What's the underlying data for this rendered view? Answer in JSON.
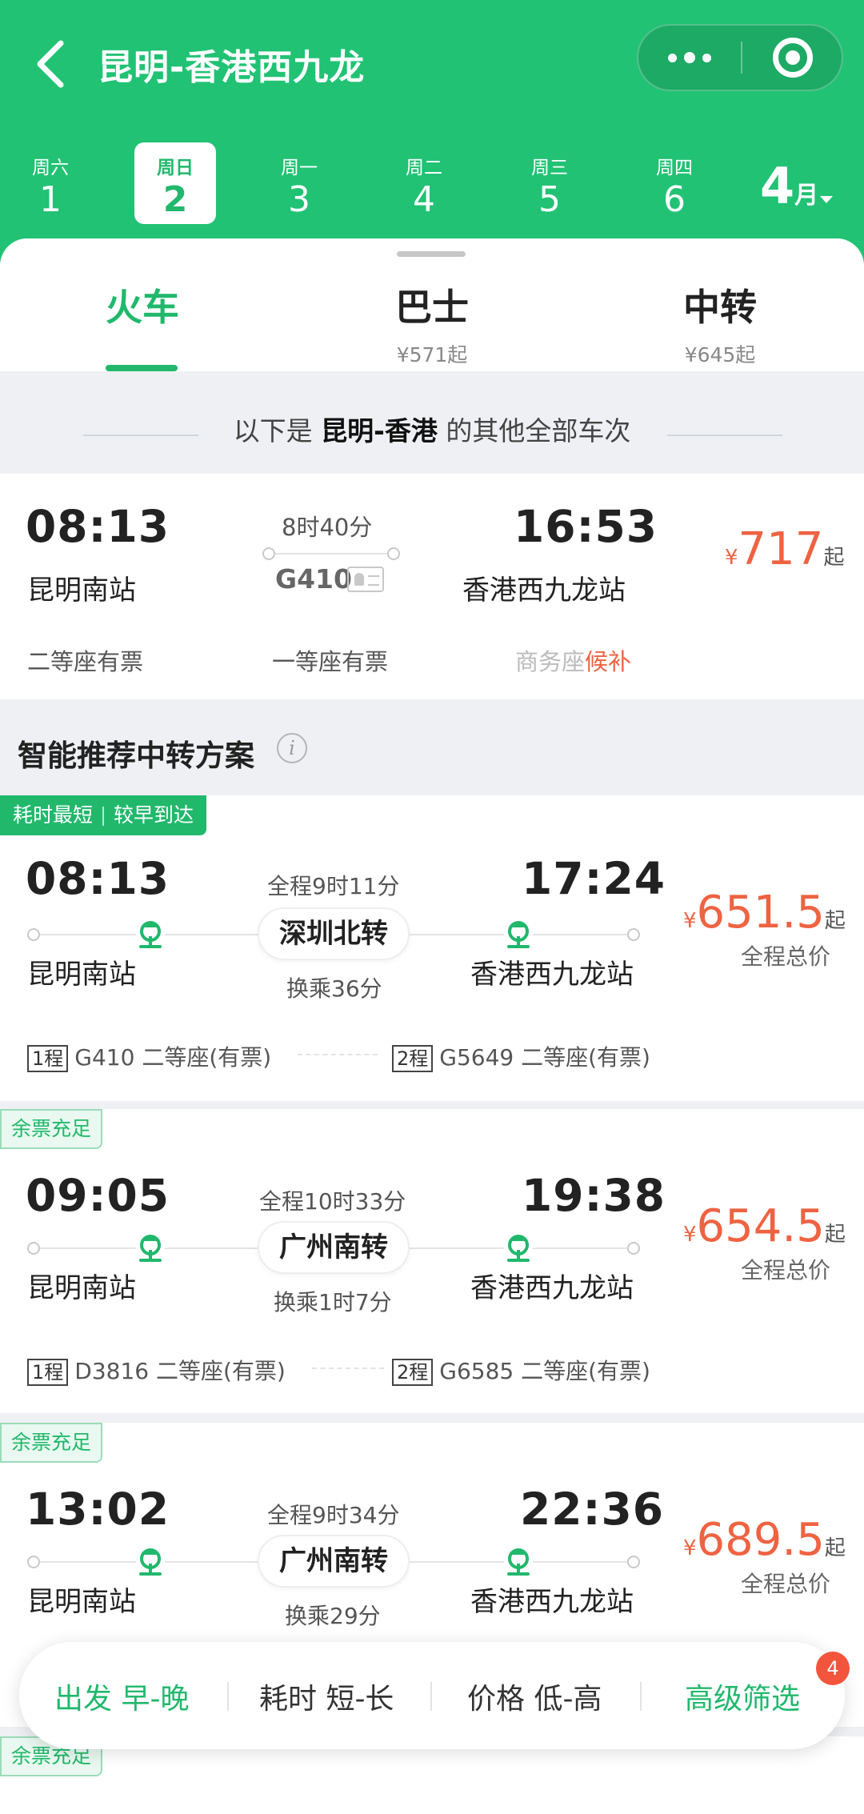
{
  "header": {
    "title": "昆明-香港西九龙",
    "dates": [
      {
        "weekday": "周六",
        "day": "1"
      },
      {
        "weekday": "周日",
        "day": "2"
      },
      {
        "weekday": "周一",
        "day": "3"
      },
      {
        "weekday": "周二",
        "day": "4"
      },
      {
        "weekday": "周三",
        "day": "5"
      },
      {
        "weekday": "周四",
        "day": "6"
      }
    ],
    "month_num": "4",
    "month_unit": "月"
  },
  "tabs": [
    {
      "label": "火车",
      "sub": ""
    },
    {
      "label": "巴士",
      "sub": "¥571起"
    },
    {
      "label": "中转",
      "sub": "¥645起"
    }
  ],
  "notice": {
    "prefix": "以下是 ",
    "route": "昆明-香港",
    "suffix": " 的其他全部车次"
  },
  "direct": {
    "depart_time": "08:13",
    "depart_station": "昆明南站",
    "duration": "8时40分",
    "train_no": "G410",
    "arrive_time": "16:53",
    "arrive_station": "香港西九龙站",
    "price_currency": "¥",
    "price": "717",
    "price_suffix": "起",
    "seat1": "二等座有票",
    "seat2": "一等座有票",
    "seat3_label": "商务座",
    "seat3_status": "候补"
  },
  "smart": {
    "title": "智能推荐中转方案",
    "info_icon": "i"
  },
  "transfers": [
    {
      "tags": [
        "耗时最短",
        "较早到达"
      ],
      "depart_time": "08:13",
      "depart_station": "昆明南站",
      "total": "全程9时11分",
      "via": "深圳北转",
      "wait": "换乘36分",
      "arrive_time": "17:24",
      "arrive_station": "香港西九龙站",
      "price_currency": "¥",
      "price": "651.5",
      "price_suffix": "起",
      "price_label": "全程总价",
      "leg1_badge": "1程",
      "leg1": "G410 二等座(有票)",
      "leg2_badge": "2程",
      "leg2": "G5649 二等座(有票)"
    },
    {
      "tags": [
        "余票充足"
      ],
      "depart_time": "09:05",
      "depart_station": "昆明南站",
      "total": "全程10时33分",
      "via": "广州南转",
      "wait": "换乘1时7分",
      "arrive_time": "19:38",
      "arrive_station": "香港西九龙站",
      "price_currency": "¥",
      "price": "654.5",
      "price_suffix": "起",
      "price_label": "全程总价",
      "leg1_badge": "1程",
      "leg1": "D3816 二等座(有票)",
      "leg2_badge": "2程",
      "leg2": "G6585 二等座(有票)"
    },
    {
      "tags": [
        "余票充足"
      ],
      "depart_time": "13:02",
      "depart_station": "昆明南站",
      "total": "全程9时34分",
      "via": "广州南转",
      "wait": "换乘29分",
      "arrive_time": "22:36",
      "arrive_station": "香港西九龙站",
      "price_currency": "¥",
      "price": "689.5",
      "price_suffix": "起",
      "price_label": "全程总价"
    },
    {
      "tags": [
        "余票充足"
      ]
    }
  ],
  "filter": {
    "depart_label": "出发 早-晚",
    "duration_label": "耗时 短-长",
    "price_label": "价格 低-高",
    "advanced_label": "高级筛选",
    "advanced_count": "4"
  },
  "colors": {
    "brand_green": "#21c274",
    "accent_green": "#21b86c",
    "price_red": "#ee6342",
    "badge_red": "#f2553b"
  },
  "icons": [
    "back-arrow-icon",
    "more-dots-icon",
    "target-icon",
    "rail-icon",
    "id-card-icon",
    "info-icon",
    "chevron-down-icon"
  ]
}
